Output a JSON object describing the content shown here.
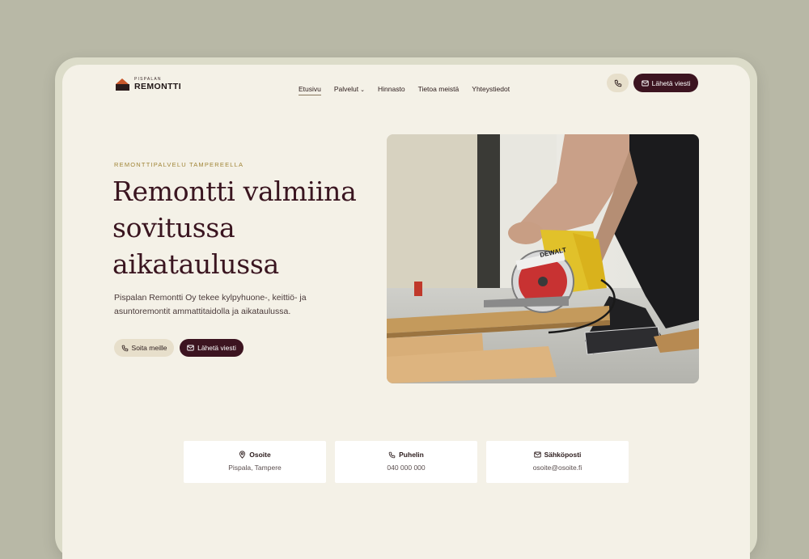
{
  "logo": {
    "small": "PISPALAN",
    "big": "REMONTTI"
  },
  "nav": {
    "items": [
      {
        "label": "Etusivu",
        "active": true
      },
      {
        "label": "Palvelut",
        "has_dropdown": true
      },
      {
        "label": "Hinnasto"
      },
      {
        "label": "Tietoa meistä"
      },
      {
        "label": "Yhteystiedot"
      }
    ]
  },
  "header": {
    "phone_icon": "phone-icon",
    "send_label": "Lähetä viesti",
    "send_icon": "mail-icon"
  },
  "hero": {
    "eyebrow": "REMONTTIPALVELU TAMPEREELLA",
    "headline": "Remontti valmiina sovitussa aikataulussa",
    "lead": "Pispalan Remontti Oy tekee kylpyhuone-, keittiö- ja asuntoremontit ammattitaidolla ja aikataulussa.",
    "call_label": "Soita meille",
    "send_label": "Lähetä viesti",
    "photo_brand": "DEWALT"
  },
  "contacts": [
    {
      "icon": "map-pin-icon",
      "title": "Osoite",
      "value": "Pispala, Tampere"
    },
    {
      "icon": "phone-icon",
      "title": "Puhelin",
      "value": "040 000 000"
    },
    {
      "icon": "mail-icon",
      "title": "Sähköposti",
      "value": "osoite@osoite.fi"
    }
  ],
  "colors": {
    "brand": "#3c1420",
    "accent": "#a08436",
    "background": "#f4f1e7",
    "logo_roof": "#c8562a"
  }
}
